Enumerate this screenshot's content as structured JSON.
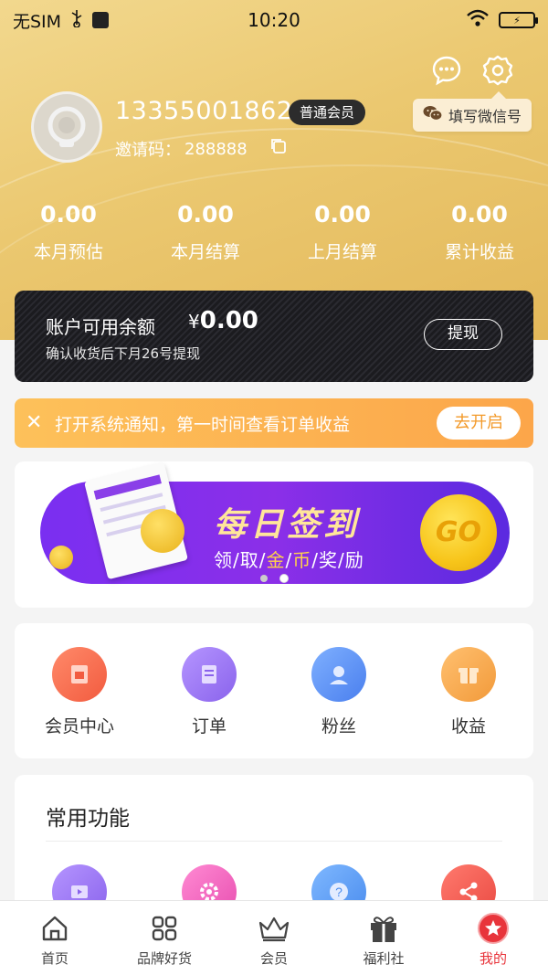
{
  "status_bar": {
    "carrier": "无SIM",
    "time": "10:20"
  },
  "header": {
    "wechat_button_label": "填写微信号",
    "phone": "13355001862",
    "member_level": "普通会员",
    "invite_label": "邀请码：",
    "invite_code": "288888"
  },
  "stats": [
    {
      "value": "0.00",
      "label": "本月预估"
    },
    {
      "value": "0.00",
      "label": "本月结算"
    },
    {
      "value": "0.00",
      "label": "上月结算"
    },
    {
      "value": "0.00",
      "label": "累计收益"
    }
  ],
  "balance": {
    "title": "账户可用余额",
    "currency": "¥",
    "amount": "0.00",
    "note": "确认收货后下月26号提现",
    "withdraw_label": "提现"
  },
  "notice": {
    "close_glyph": "✕",
    "text": "打开系统通知，第一时间查看订单收益",
    "open_label": "去开启"
  },
  "banner": {
    "title": "每日签到",
    "subtitle_parts": [
      "领",
      "/",
      "取",
      "/",
      "金",
      "/",
      "币",
      "/",
      "奖",
      "/",
      "励"
    ],
    "go_label": "GO",
    "page_count": 2,
    "active_page": 2
  },
  "quick_actions": [
    {
      "label": "会员中心",
      "icon": "member-center-icon",
      "color": "#f76a4f"
    },
    {
      "label": "订单",
      "icon": "order-icon",
      "color": "#9a74f2"
    },
    {
      "label": "粉丝",
      "icon": "fans-icon",
      "color": "#5a8ef5"
    },
    {
      "label": "收益",
      "icon": "earnings-icon",
      "color": "#f7a44a"
    }
  ],
  "common_functions": {
    "title": "常用功能",
    "items": [
      {
        "icon": "video-icon",
        "color": "#9a74f2"
      },
      {
        "icon": "settings-gear-icon",
        "color": "#f36ac3"
      },
      {
        "icon": "help-question-icon",
        "color": "#5a9ef5"
      },
      {
        "icon": "share-icon",
        "color": "#f2574f"
      }
    ]
  },
  "tabbar": [
    {
      "label": "首页",
      "icon": "home-icon"
    },
    {
      "label": "品牌好货",
      "icon": "grid-icon"
    },
    {
      "label": "会员",
      "icon": "crown-icon"
    },
    {
      "label": "福利社",
      "icon": "gift-icon"
    },
    {
      "label": "我的",
      "icon": "star-badge-icon",
      "active": true
    }
  ],
  "colors": {
    "header_gold": "#ebc870",
    "accent_red": "#e8343b",
    "notice_orange": "#fca64a"
  }
}
